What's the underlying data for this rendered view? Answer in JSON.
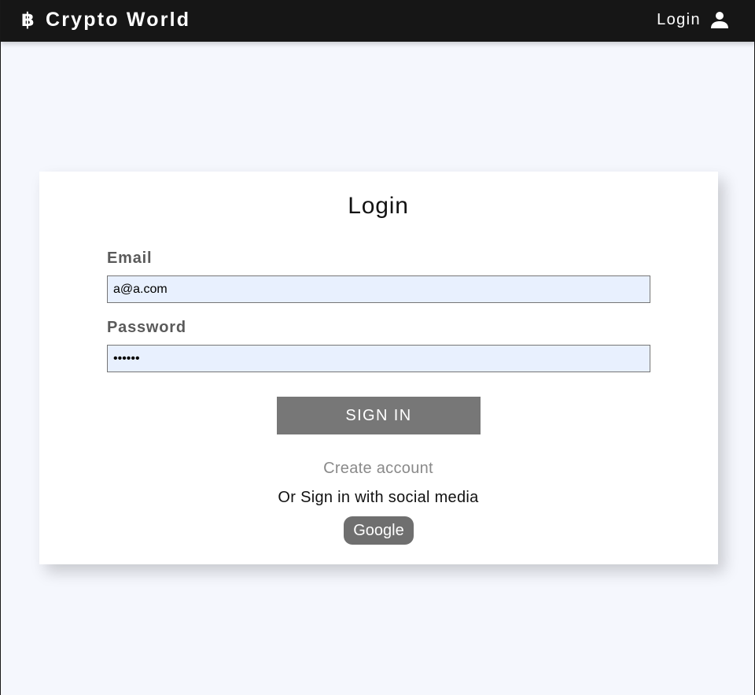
{
  "navbar": {
    "brand_icon": "฿",
    "brand_text": "Crypto World",
    "login_label": "Login",
    "user_icon": "user-icon"
  },
  "login_form": {
    "title": "Login",
    "email": {
      "label": "Email",
      "value": "a@a.com"
    },
    "password": {
      "label": "Password",
      "value": "••••••"
    },
    "sign_in_label": "SIGN IN",
    "create_account_label": "Create account",
    "social_text": "Or Sign in with social media",
    "google_label": "Google"
  },
  "colors": {
    "navbar_bg": "#161616",
    "page_bg": "#f5f7fd",
    "input_bg": "#e8f0fe",
    "button_bg": "#777777"
  }
}
